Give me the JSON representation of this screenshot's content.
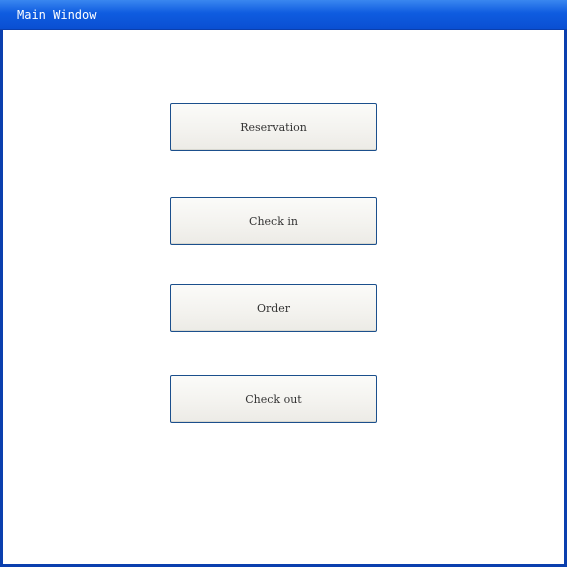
{
  "window": {
    "title": "Main Window"
  },
  "buttons": {
    "reservation": "Reservation",
    "check_in": "Check in",
    "order": "Order",
    "check_out": "Check out"
  },
  "colors": {
    "titlebar": "#0f5ce0",
    "border": "#0a3fae",
    "button_border": "#1b4f8c",
    "button_face": "#f3f2ee"
  }
}
